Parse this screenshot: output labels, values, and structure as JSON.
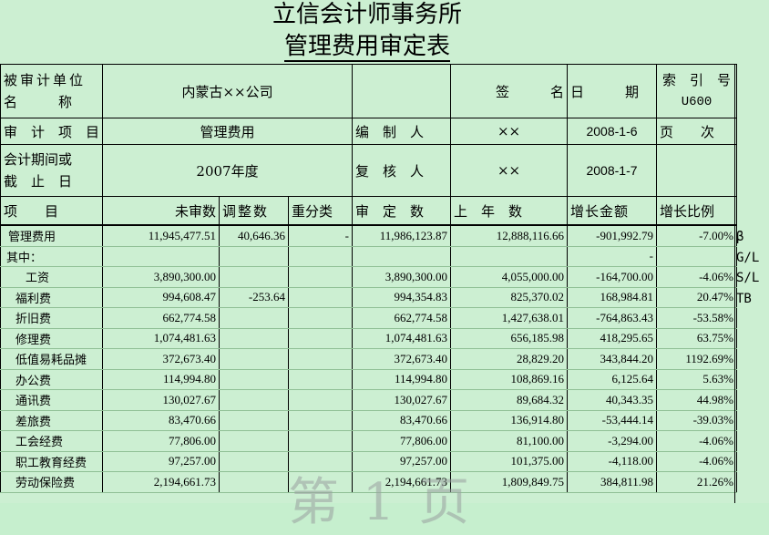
{
  "title": "立信会计师事务所",
  "subtitle": "管理费用审定表",
  "header": {
    "entity_label": "被审计单位名称",
    "entity_label_l1": "被审计单位",
    "entity_label_l2": "名　　　称",
    "entity_value": "内蒙古××公司",
    "sign_label": "签　　　名",
    "date_label": "日　　　期",
    "index_label": "索　引　号",
    "index_value": "U600",
    "audit_item_label": "审　计　项　目",
    "audit_item_value": "管理费用",
    "preparer_label": "编　制　人",
    "preparer_value": "××",
    "preparer_date": "2008-1-6",
    "page_label": "页　　次",
    "period_label_l1": "会计期间或",
    "period_label_l2": "截　止　日",
    "period_value": "2007年度",
    "reviewer_label": "复　核　人",
    "reviewer_value": "××",
    "reviewer_date": "2008-1-7"
  },
  "columns": [
    "项　　目",
    "未审数",
    "调整数",
    "重分类",
    "审　定　数",
    "上　年　数",
    "增长金额",
    "增长比例"
  ],
  "rows": [
    {
      "item": "管理费用",
      "unaudited": "11,945,477.51",
      "adjust": "40,646.36",
      "reclass": "-",
      "audited": "11,986,123.87",
      "prior": "12,888,116.66",
      "growth": "-901,992.79",
      "ratio": "-7.00%",
      "mark": "β"
    },
    {
      "item": "其中：",
      "unaudited": "",
      "adjust": "",
      "reclass": "",
      "audited": "",
      "prior": "",
      "growth": "-",
      "ratio": "",
      "mark": "G/L"
    },
    {
      "item": "　工资",
      "unaudited": "3,890,300.00",
      "adjust": "",
      "reclass": "",
      "audited": "3,890,300.00",
      "prior": "4,055,000.00",
      "growth": "-164,700.00",
      "ratio": "-4.06%",
      "mark": "S/L"
    },
    {
      "item": "福利费",
      "unaudited": "994,608.47",
      "adjust": "-253.64",
      "reclass": "",
      "audited": "994,354.83",
      "prior": "825,370.02",
      "growth": "168,984.81",
      "ratio": "20.47%",
      "mark": "TB"
    },
    {
      "item": "折旧费",
      "unaudited": "662,774.58",
      "adjust": "",
      "reclass": "",
      "audited": "662,774.58",
      "prior": "1,427,638.01",
      "growth": "-764,863.43",
      "ratio": "-53.58%",
      "mark": ""
    },
    {
      "item": "修理费",
      "unaudited": "1,074,481.63",
      "adjust": "",
      "reclass": "",
      "audited": "1,074,481.63",
      "prior": "656,185.98",
      "growth": "418,295.65",
      "ratio": "63.75%",
      "mark": ""
    },
    {
      "item": "低值易耗品摊",
      "unaudited": "372,673.40",
      "adjust": "",
      "reclass": "",
      "audited": "372,673.40",
      "prior": "28,829.20",
      "growth": "343,844.20",
      "ratio": "1192.69%",
      "mark": ""
    },
    {
      "item": "办公费",
      "unaudited": "114,994.80",
      "adjust": "",
      "reclass": "",
      "audited": "114,994.80",
      "prior": "108,869.16",
      "growth": "6,125.64",
      "ratio": "5.63%",
      "mark": ""
    },
    {
      "item": "通讯费",
      "unaudited": "130,027.67",
      "adjust": "",
      "reclass": "",
      "audited": "130,027.67",
      "prior": "89,684.32",
      "growth": "40,343.35",
      "ratio": "44.98%",
      "mark": ""
    },
    {
      "item": "差旅费",
      "unaudited": "83,470.66",
      "adjust": "",
      "reclass": "",
      "audited": "83,470.66",
      "prior": "136,914.80",
      "growth": "-53,444.14",
      "ratio": "-39.03%",
      "mark": ""
    },
    {
      "item": "工会经费",
      "unaudited": "77,806.00",
      "adjust": "",
      "reclass": "",
      "audited": "77,806.00",
      "prior": "81,100.00",
      "growth": "-3,294.00",
      "ratio": "-4.06%",
      "mark": ""
    },
    {
      "item": "职工教育经费",
      "unaudited": "97,257.00",
      "adjust": "",
      "reclass": "",
      "audited": "97,257.00",
      "prior": "101,375.00",
      "growth": "-4,118.00",
      "ratio": "-4.06%",
      "mark": ""
    },
    {
      "item": "劳动保险费",
      "unaudited": "2,194,661.73",
      "adjust": "",
      "reclass": "",
      "audited": "2,194,661.73",
      "prior": "1,809,849.75",
      "growth": "384,811.98",
      "ratio": "21.26%",
      "mark": ""
    }
  ],
  "watermark": "第 1 页"
}
